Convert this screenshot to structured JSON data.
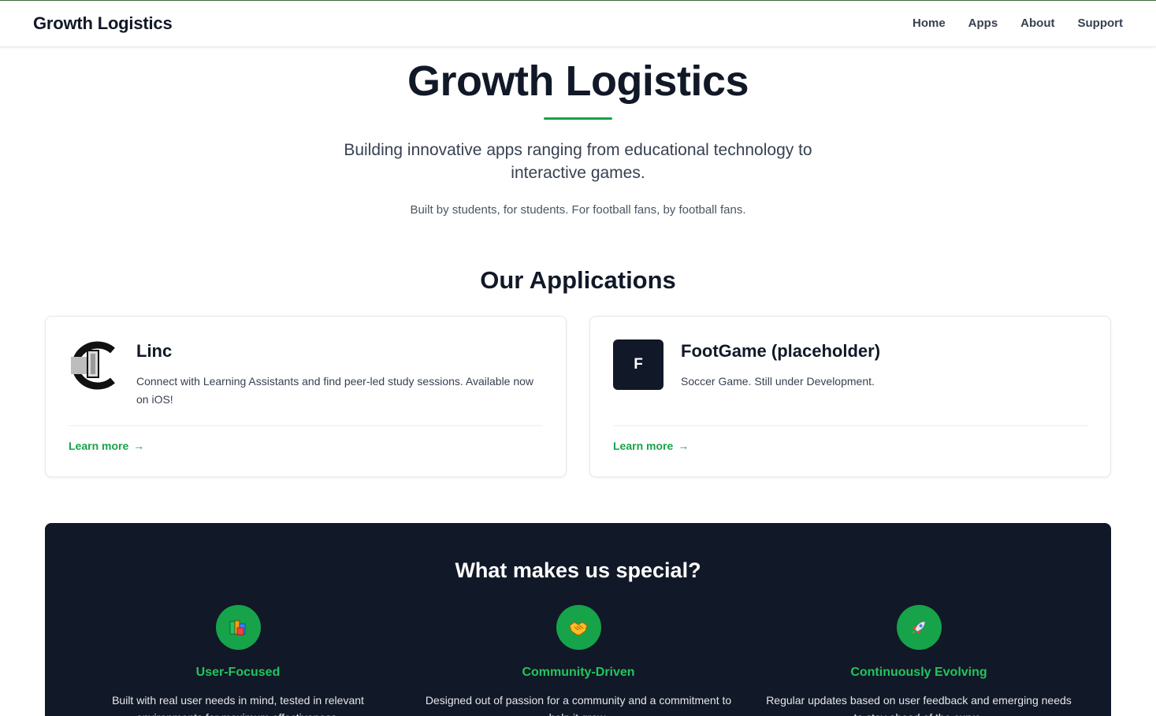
{
  "nav": {
    "brand": "Growth Logistics",
    "links": [
      "Home",
      "Apps",
      "About",
      "Support"
    ]
  },
  "hero": {
    "title": "Growth Logistics",
    "subtitle": "Building innovative apps ranging from educational technology to interactive games.",
    "tagline": "Built by students, for students. For football fans, by football fans."
  },
  "apps": {
    "heading": "Our Applications",
    "items": [
      {
        "name": "Linc",
        "description": "Connect with Learning Assistants and find peer-led study sessions. Available now on iOS!",
        "link": "Learn more",
        "icon": "linc-logo"
      },
      {
        "name": "FootGame (placeholder)",
        "description": "Soccer Game. Still under Development.",
        "link": "Learn more",
        "icon_letter": "F"
      }
    ],
    "arrow": "→"
  },
  "special": {
    "heading": "What makes us special?",
    "features": [
      {
        "title": "User-Focused",
        "icon": "books-icon",
        "text": "Built with real user needs in mind, tested in relevant environments for maximum effectiveness."
      },
      {
        "title": "Community-Driven",
        "icon": "handshake-icon",
        "text": "Designed out of passion for a community and a commitment to help it grow."
      },
      {
        "title": "Continuously Evolving",
        "icon": "rocket-icon",
        "text": "Regular updates based on user feedback and emerging needs to stay ahead of the curve."
      }
    ]
  },
  "colors": {
    "accent": "#16a34a",
    "accent_text": "#22c55e",
    "dark": "#111827"
  }
}
